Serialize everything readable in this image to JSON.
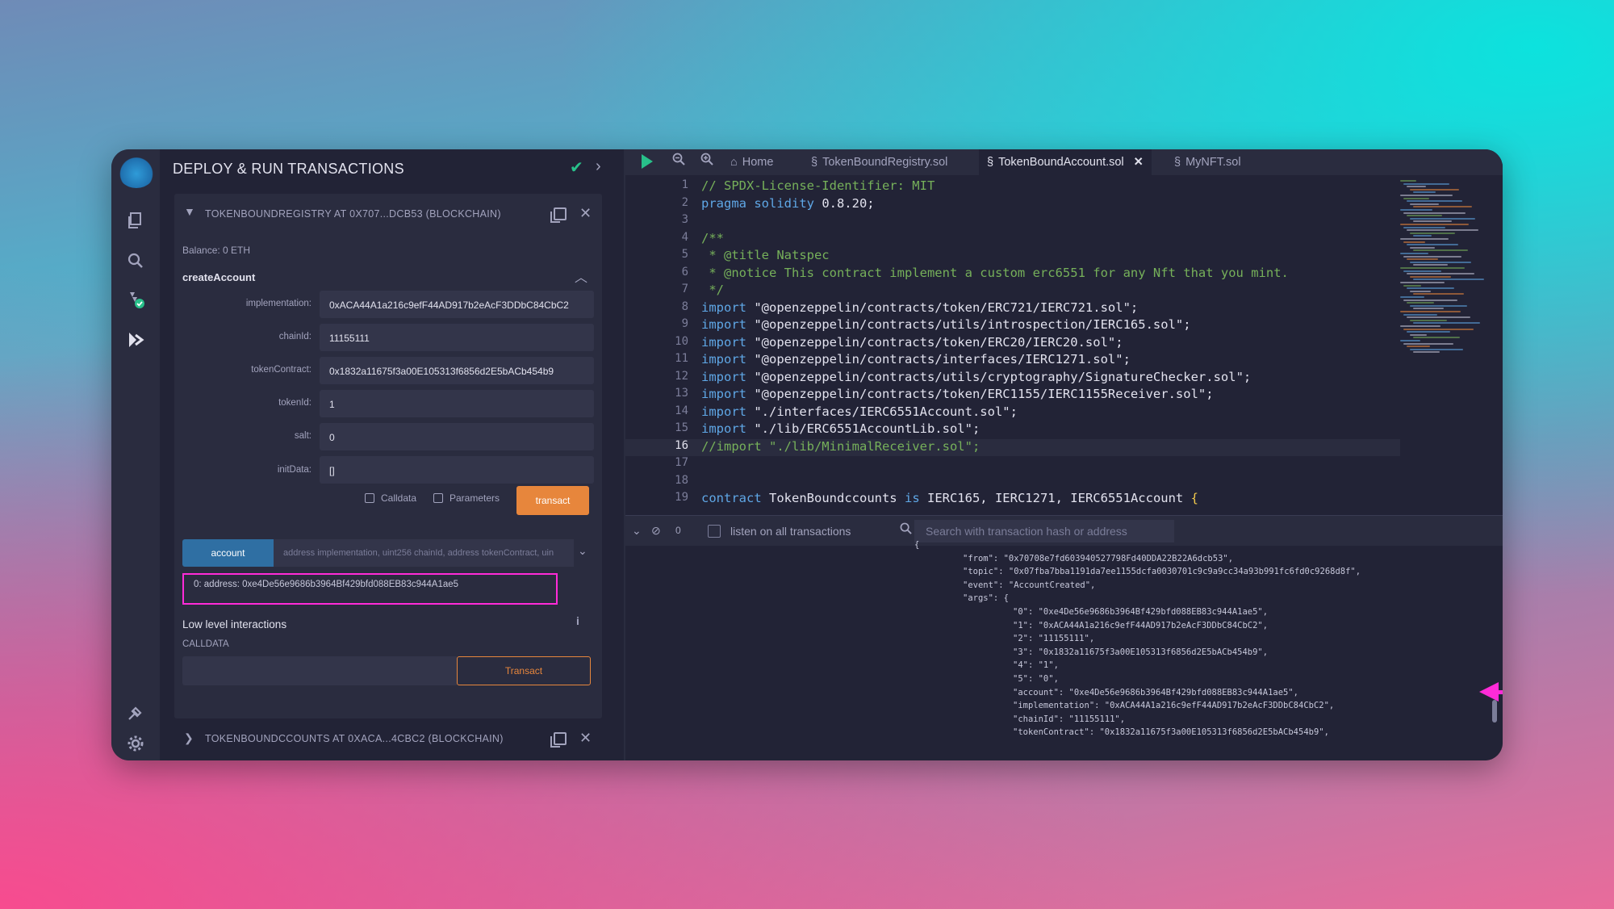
{
  "panel": {
    "title": "DEPLOY & RUN TRANSACTIONS",
    "contract_header": "TOKENBOUNDREGISTRY AT 0X707...DCB53 (BLOCKCHAIN)",
    "balance": "Balance: 0 ETH",
    "function_name": "createAccount",
    "params": [
      {
        "label": "implementation:",
        "value": "0xACA44A1a216c9efF44AD917b2eAcF3DDbC84CbC2"
      },
      {
        "label": "chainId:",
        "value": "11155111"
      },
      {
        "label": "tokenContract:",
        "value": "0x1832a11675f3a00E105313f6856d2E5bACb454b9"
      },
      {
        "label": "tokenId:",
        "value": "1"
      },
      {
        "label": "salt:",
        "value": "0"
      },
      {
        "label": "initData:",
        "value": "[]"
      }
    ],
    "calldata_label": "Calldata",
    "parameters_label": "Parameters",
    "transact_label": "transact",
    "account_label": "account",
    "account_placeholder": "address implementation, uint256 chainId, address tokenContract, uin",
    "account_result": "0: address: 0xe4De56e9686b3964Bf429bfd088EB83c944A1ae5",
    "low_level_title": "Low level interactions",
    "calldata_caption": "CALLDATA",
    "transact2_label": "Transact",
    "bottom_contract": "TOKENBOUNDCCOUNTS AT 0XACA...4CBC2 (BLOCKCHAIN)"
  },
  "tabs": {
    "home": "Home",
    "registry": "TokenBoundRegistry.sol",
    "account": "TokenBoundAccount.sol",
    "nft": "MyNFT.sol"
  },
  "code": {
    "current_line": 16,
    "lines": [
      {
        "n": "1",
        "parts": [
          {
            "t": "// SPDX-License-Identifier: MIT",
            "c": "c-comment"
          }
        ]
      },
      {
        "n": "2",
        "parts": [
          {
            "t": "pragma solidity ",
            "c": "c-kw"
          },
          {
            "t": "0.8.20;",
            "c": "c-plain"
          }
        ]
      },
      {
        "n": "3",
        "parts": []
      },
      {
        "n": "4",
        "parts": [
          {
            "t": "/**",
            "c": "c-comment"
          }
        ]
      },
      {
        "n": "5",
        "parts": [
          {
            "t": " * @title Natspec",
            "c": "c-comment"
          }
        ]
      },
      {
        "n": "6",
        "parts": [
          {
            "t": " * @notice This contract implement a custom erc6551 for any Nft that you mint.",
            "c": "c-comment"
          }
        ]
      },
      {
        "n": "7",
        "parts": [
          {
            "t": " */",
            "c": "c-comment"
          }
        ]
      },
      {
        "n": "8",
        "parts": [
          {
            "t": "import ",
            "c": "c-kw"
          },
          {
            "t": "\"@openzeppelin/contracts/token/ERC721/IERC721.sol\";",
            "c": "c-str"
          }
        ]
      },
      {
        "n": "9",
        "parts": [
          {
            "t": "import ",
            "c": "c-kw"
          },
          {
            "t": "\"@openzeppelin/contracts/utils/introspection/IERC165.sol\";",
            "c": "c-str"
          }
        ]
      },
      {
        "n": "10",
        "parts": [
          {
            "t": "import ",
            "c": "c-kw"
          },
          {
            "t": "\"@openzeppelin/contracts/token/ERC20/IERC20.sol\";",
            "c": "c-str"
          }
        ]
      },
      {
        "n": "11",
        "parts": [
          {
            "t": "import ",
            "c": "c-kw"
          },
          {
            "t": "\"@openzeppelin/contracts/interfaces/IERC1271.sol\";",
            "c": "c-str"
          }
        ]
      },
      {
        "n": "12",
        "parts": [
          {
            "t": "import ",
            "c": "c-kw"
          },
          {
            "t": "\"@openzeppelin/contracts/utils/cryptography/SignatureChecker.sol\";",
            "c": "c-str"
          }
        ]
      },
      {
        "n": "13",
        "parts": [
          {
            "t": "import ",
            "c": "c-kw"
          },
          {
            "t": "\"@openzeppelin/contracts/token/ERC1155/IERC1155Receiver.sol\";",
            "c": "c-str"
          }
        ]
      },
      {
        "n": "14",
        "parts": [
          {
            "t": "import ",
            "c": "c-kw"
          },
          {
            "t": "\"./interfaces/IERC6551Account.sol\";",
            "c": "c-str"
          }
        ]
      },
      {
        "n": "15",
        "parts": [
          {
            "t": "import ",
            "c": "c-kw"
          },
          {
            "t": "\"./lib/ERC6551AccountLib.sol\";",
            "c": "c-str"
          }
        ]
      },
      {
        "n": "16",
        "parts": [
          {
            "t": "//import \"./lib/MinimalReceiver.sol\";",
            "c": "c-comment"
          }
        ]
      },
      {
        "n": "17",
        "parts": []
      },
      {
        "n": "18",
        "parts": []
      },
      {
        "n": "19",
        "parts": [
          {
            "t": "contract ",
            "c": "c-kw"
          },
          {
            "t": "TokenBoundccounts ",
            "c": "c-plain"
          },
          {
            "t": "is ",
            "c": "c-kw"
          },
          {
            "t": "IERC165, IERC1271, IERC6551Account ",
            "c": "c-plain"
          },
          {
            "t": "{",
            "c": "c-yellow"
          }
        ]
      }
    ]
  },
  "terminal": {
    "pending_count": "0",
    "listen_label": "listen on all transactions",
    "search_placeholder": "Search with transaction hash or address",
    "lines": [
      "{",
      "\"from\": \"0x70708e7fd603940527798Fd40DDA22B22A6dcb53\",",
      "\"topic\": \"0x07fba7bba1191da7ee1155dcfa0030701c9c9a9cc34a93b991fc6fd0c9268d8f\",",
      "\"event\": \"AccountCreated\",",
      "\"args\": {",
      "\"0\": \"0xe4De56e9686b3964Bf429bfd088EB83c944A1ae5\",",
      "\"1\": \"0xACA44A1a216c9efF44AD917b2eAcF3DDbC84CbC2\",",
      "\"2\": \"11155111\",",
      "\"3\": \"0x1832a11675f3a00E105313f6856d2E5bACb454b9\",",
      "\"4\": \"1\",",
      "\"5\": \"0\",",
      "\"account\": \"0xe4De56e9686b3964Bf429bfd088EB83c944A1ae5\",",
      "\"implementation\": \"0xACA44A1a216c9efF44AD917b2eAcF3DDbC84CbC2\",",
      "\"chainId\": \"11155111\",",
      "\"tokenContract\": \"0x1832a11675f3a00E105313f6856d2E5bACb454b9\","
    ]
  },
  "colors": {
    "accent_orange": "#e7863c",
    "accent_blue": "#2f6fa3",
    "highlight_magenta": "#ff2bd8",
    "success_green": "#28c08a"
  }
}
